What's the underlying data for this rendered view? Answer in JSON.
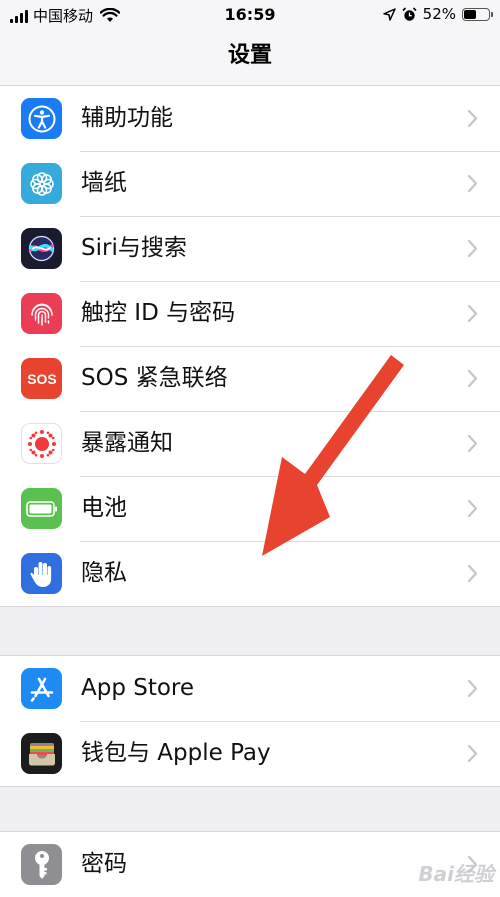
{
  "status": {
    "carrier": "中国移动",
    "time": "16:59",
    "battery_text": "52%",
    "battery_level": 0.52
  },
  "nav": {
    "title": "设置"
  },
  "groups": [
    {
      "items": [
        {
          "label": "辅助功能",
          "icon": "accessibility-icon",
          "color": "#1a7cf5"
        },
        {
          "label": "墙纸",
          "icon": "wallpaper-flower-icon",
          "color": "#37aadc"
        },
        {
          "label": "Siri与搜索",
          "icon": "siri-icon",
          "color": "#1b1b2f"
        },
        {
          "label": "触控 ID 与密码",
          "icon": "fingerprint-icon",
          "color": "#ec3d56"
        },
        {
          "label": "SOS 紧急联络",
          "icon": "sos-icon",
          "color": "#e8432f"
        },
        {
          "label": "暴露通知",
          "icon": "exposure-notification-icon",
          "color": "#ffffff"
        },
        {
          "label": "电池",
          "icon": "battery-icon",
          "color": "#5ac04f"
        },
        {
          "label": "隐私",
          "icon": "hand-icon",
          "color": "#2f6fe0"
        }
      ]
    },
    {
      "items": [
        {
          "label": "App Store",
          "icon": "app-store-icon",
          "color": "#1d8bf1"
        },
        {
          "label": "钱包与 Apple Pay",
          "icon": "wallet-icon",
          "color": "#1c1c1e"
        }
      ]
    },
    {
      "items": [
        {
          "label": "密码",
          "icon": "key-icon",
          "color": "#8e8e93"
        }
      ]
    }
  ],
  "annotation": {
    "arrow_color": "#e8432f"
  },
  "watermark": "Bai经验"
}
